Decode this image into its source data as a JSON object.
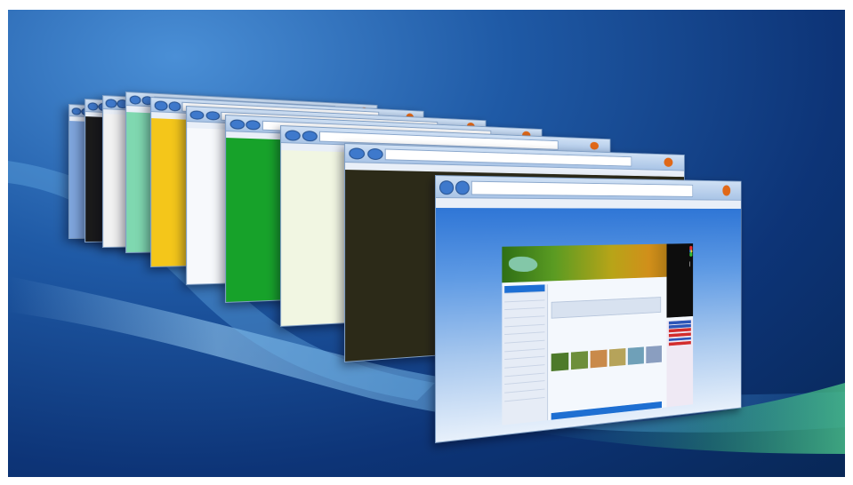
{
  "scene": {
    "description_free": true,
    "colors": {
      "desktop_top": "#4a8fd6",
      "desktop_mid": "#1f5aa6",
      "desktop_bottom": "#082756",
      "swoosh": "#79c0ee",
      "swoosh_green": "#3ec27d",
      "firefox_orange": "#e06818"
    }
  },
  "windows": [
    {
      "name": "window-1",
      "content_color": "#7fa6de",
      "icon": "browser-window"
    },
    {
      "name": "window-2",
      "content_color": "#1a1a1a",
      "icon": "browser-window"
    },
    {
      "name": "window-3",
      "content_color": "#f2f2f2",
      "icon": "browser-window"
    },
    {
      "name": "window-4",
      "content_color": "#7fd8b0",
      "icon": "browser-window"
    },
    {
      "name": "window-5",
      "content_color": "#f4c61a",
      "icon": "browser-window"
    },
    {
      "name": "window-6",
      "content_color": "#f7f9fc",
      "icon": "browser-window"
    },
    {
      "name": "window-7",
      "content_color": "#17a22a",
      "icon": "browser-window"
    },
    {
      "name": "window-8",
      "content_color": "#f1f6e2",
      "icon": "browser-window"
    },
    {
      "name": "window-9",
      "content_color": "#2c2a18",
      "icon": "browser-window"
    },
    {
      "name": "window-10",
      "content_color": "#3c80d9",
      "icon": "browser-window"
    }
  ],
  "front_window": {
    "thumb_colors": [
      "#4d7a2a",
      "#6d8f3a",
      "#c98a4a",
      "#b6a35a",
      "#6fa0b8",
      "#8a9ec0"
    ]
  }
}
